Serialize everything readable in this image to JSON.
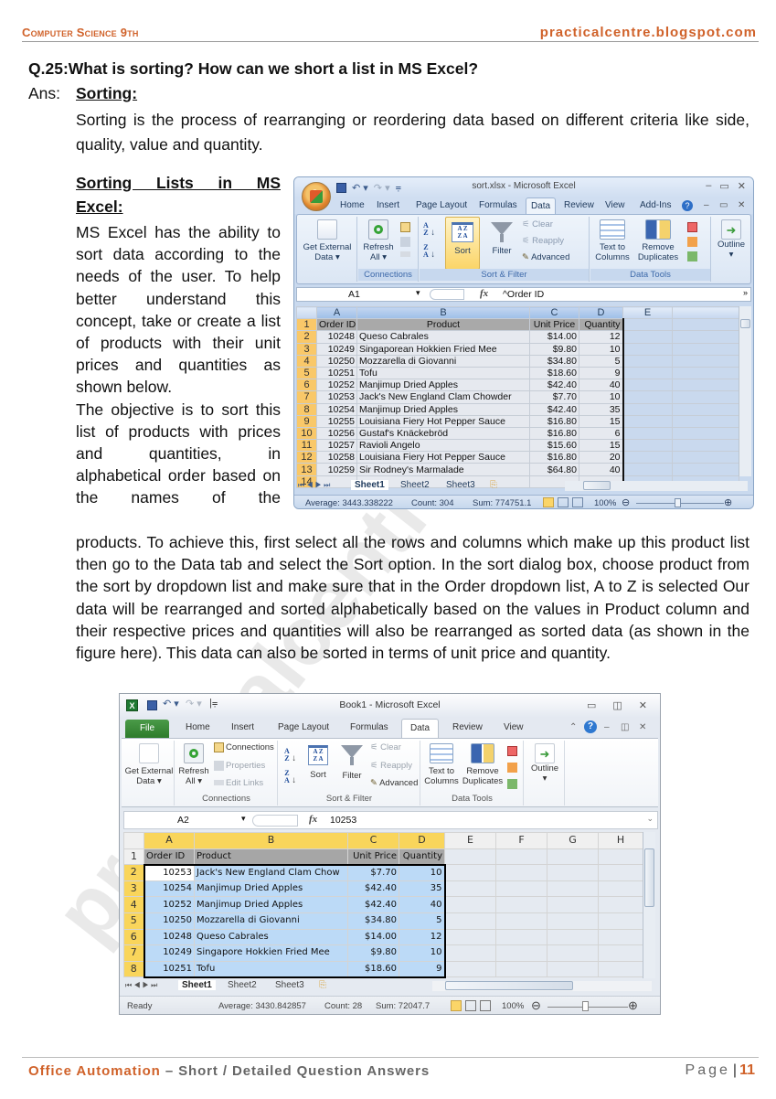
{
  "header": {
    "subject": "Computer Science 9th",
    "site": "practicalcentre.blogspot.com"
  },
  "watermark": "practicalcentre",
  "question": {
    "number": "Q.25:",
    "text": "What is sorting? How can we short a list in MS Excel?"
  },
  "answer": {
    "label": "Ans:",
    "heading": "Sorting:",
    "definition": "Sorting is the process of rearranging or reordering data based on different criteria like side, quality, value and quantity.",
    "subheading_line1": "Sorting Lists in MS",
    "subheading_line2": "Excel:",
    "side_para1": "MS Excel has the ability to sort data according to the needs of the user. To help better understand this concept, take or create a list of products with their unit prices and quantities as shown below.",
    "side_para2": "The objective is to sort this list of products with prices and quantities, in alphabetical order based on the names of the",
    "full_para": "products. To achieve this, first select all the rows and columns which make up this product list then go to the Data tab and select the Sort option.  In the sort dialog box, choose product from the sort by dropdown list and make sure that in the Order dropdown list, A to Z is selected  Our data will be rearranged and sorted alphabetically based on the values in Product column and their respective prices and quantities will also be rearranged as sorted data (as shown in the figure here). This data can also be sorted in terms of unit price and quantity."
  },
  "excel2007": {
    "title": "sort.xlsx - Microsoft Excel",
    "qat": {
      "save": "save-icon",
      "undo": "↶ ▾",
      "redo": "↷ ▾",
      "customize": "⩦"
    },
    "window_controls": [
      "–",
      "▭",
      "✕"
    ],
    "tabs": [
      "Home",
      "Insert",
      "Page Layout",
      "Formulas",
      "Data",
      "Review",
      "View",
      "Add-Ins"
    ],
    "active_tab": "Data",
    "help_icon": "?",
    "groups": {
      "get_external": {
        "label1": "Get External",
        "label2": "Data ▾"
      },
      "connections": {
        "label": "Connections",
        "refresh1": "Refresh",
        "refresh2": "All ▾"
      },
      "sort_filter": {
        "label": "Sort & Filter",
        "sort": "Sort",
        "filter": "Filter",
        "clear": "Clear",
        "reapply": "Reapply",
        "advanced": "Advanced",
        "az": "A↓Z",
        "za": "Z↓A"
      },
      "data_tools": {
        "label": "Data Tools",
        "text_to1": "Text to",
        "text_to2": "Columns",
        "remove1": "Remove",
        "remove2": "Duplicates"
      },
      "outline": {
        "label": "Outline",
        "arrow": "▾"
      }
    },
    "name_box": "A1",
    "fx": "fx",
    "formula": "^Order ID",
    "columns": [
      "A",
      "B",
      "C",
      "D",
      "E"
    ],
    "header_row": [
      "Order ID",
      "Product",
      "Unit Price",
      "Quantity"
    ],
    "rows": [
      [
        "10248",
        "Queso Cabrales",
        "$14.00",
        "12"
      ],
      [
        "10249",
        "Singaporean Hokkien Fried Mee",
        "$9.80",
        "10"
      ],
      [
        "10250",
        "Mozzarella di Giovanni",
        "$34.80",
        "5"
      ],
      [
        "10251",
        "Tofu",
        "$18.60",
        "9"
      ],
      [
        "10252",
        "Manjimup Dried Apples",
        "$42.40",
        "40"
      ],
      [
        "10253",
        "Jack's New England Clam Chowder",
        "$7.70",
        "10"
      ],
      [
        "10254",
        "Manjimup Dried Apples",
        "$42.40",
        "35"
      ],
      [
        "10255",
        "Louisiana Fiery Hot Pepper Sauce",
        "$16.80",
        "15"
      ],
      [
        "10256",
        "Gustaf's Knäckebröd",
        "$16.80",
        "6"
      ],
      [
        "10257",
        "Ravioli Angelo",
        "$15.60",
        "15"
      ],
      [
        "10258",
        "Louisiana Fiery Hot Pepper Sauce",
        "$16.80",
        "20"
      ],
      [
        "10259",
        "Sir Rodney's Marmalade",
        "$64.80",
        "40"
      ]
    ],
    "sheet_tabs": [
      "Sheet1",
      "Sheet2",
      "Sheet3"
    ],
    "active_sheet": "Sheet1",
    "status": {
      "average": "Average: 3443.338222",
      "count": "Count: 304",
      "sum": "Sum: 774751.1",
      "zoom": "100%"
    }
  },
  "excel2010": {
    "title": "Book1 - Microsoft Excel",
    "window_controls": [
      "▭",
      "◫",
      "✕"
    ],
    "tabs": [
      "File",
      "Home",
      "Insert",
      "Page Layout",
      "Formulas",
      "Data",
      "Review",
      "View"
    ],
    "active_tab": "Data",
    "groups": {
      "get_external": {
        "label1": "Get External",
        "label2": "Data ▾"
      },
      "connections": {
        "label": "Connections",
        "refresh1": "Refresh",
        "refresh2": "All ▾",
        "connections": "Connections",
        "properties": "Properties",
        "edit_links": "Edit Links"
      },
      "sort_filter": {
        "label": "Sort & Filter",
        "sort": "Sort",
        "filter": "Filter",
        "clear": "Clear",
        "reapply": "Reapply",
        "advanced": "Advanced"
      },
      "data_tools": {
        "label": "Data Tools",
        "text_to1": "Text to",
        "text_to2": "Columns",
        "remove1": "Remove",
        "remove2": "Duplicates"
      },
      "outline": {
        "label": "Outline",
        "arrow": "▾"
      }
    },
    "name_box": "A2",
    "formula": "10253",
    "columns": [
      "A",
      "B",
      "C",
      "D",
      "E",
      "F",
      "G",
      "H"
    ],
    "header_row": [
      "Order ID",
      "Product",
      "Unit Price",
      "Quantity"
    ],
    "rows": [
      [
        "10253",
        "Jack's New England Clam Chow",
        "$7.70",
        "10"
      ],
      [
        "10254",
        "Manjimup Dried Apples",
        "$42.40",
        "35"
      ],
      [
        "10252",
        "Manjimup Dried Apples",
        "$42.40",
        "40"
      ],
      [
        "10250",
        "Mozzarella di Giovanni",
        "$34.80",
        "5"
      ],
      [
        "10248",
        "Queso Cabrales",
        "$14.00",
        "12"
      ],
      [
        "10249",
        "Singapore Hokkien Fried Mee",
        "$9.80",
        "10"
      ],
      [
        "10251",
        "Tofu",
        "$18.60",
        "9"
      ]
    ],
    "sheet_tabs": [
      "Sheet1",
      "Sheet2",
      "Sheet3"
    ],
    "active_sheet": "Sheet1",
    "status": {
      "ready": "Ready",
      "average": "Average: 3430.842857",
      "count": "Count: 28",
      "sum": "Sum: 72047.7",
      "zoom": "100%"
    }
  },
  "footer": {
    "course": "Office Automation",
    "section": " – Short / Detailed Question Answers",
    "page_label": "Page",
    "page_number": "11"
  }
}
